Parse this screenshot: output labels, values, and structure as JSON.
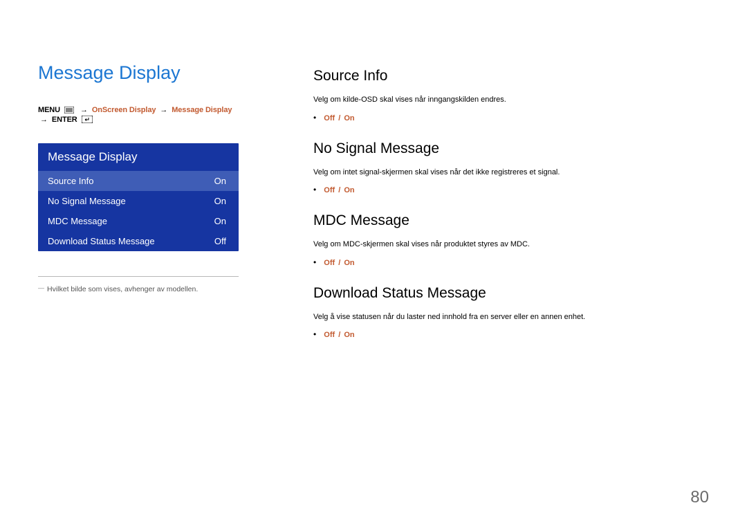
{
  "page": {
    "heading": "Message Display",
    "page_number": "80"
  },
  "breadcrumb": {
    "menu_label": "MENU",
    "parts": [
      "OnScreen Display",
      "Message Display"
    ],
    "enter_label": "ENTER"
  },
  "osd": {
    "header": "Message Display",
    "rows": [
      {
        "label": "Source Info",
        "value": "On"
      },
      {
        "label": "No Signal Message",
        "value": "On"
      },
      {
        "label": "MDC Message",
        "value": "On"
      },
      {
        "label": "Download Status Message",
        "value": "Off"
      }
    ]
  },
  "footnote": "Hvilket bilde som vises, avhenger av modellen.",
  "sections": [
    {
      "heading": "Source Info",
      "desc": "Velg om kilde-OSD skal vises når inngangskilden endres.",
      "off": "Off",
      "on": "On"
    },
    {
      "heading": "No Signal Message",
      "desc": "Velg om intet signal-skjermen skal vises når det ikke registreres et signal.",
      "off": "Off",
      "on": "On"
    },
    {
      "heading": "MDC Message",
      "desc": "Velg om MDC-skjermen skal vises når produktet styres av MDC.",
      "off": "Off",
      "on": "On"
    },
    {
      "heading": "Download Status Message",
      "desc": "Velg å vise statusen når du laster ned innhold fra en server eller en annen enhet.",
      "off": "Off",
      "on": "On"
    }
  ]
}
